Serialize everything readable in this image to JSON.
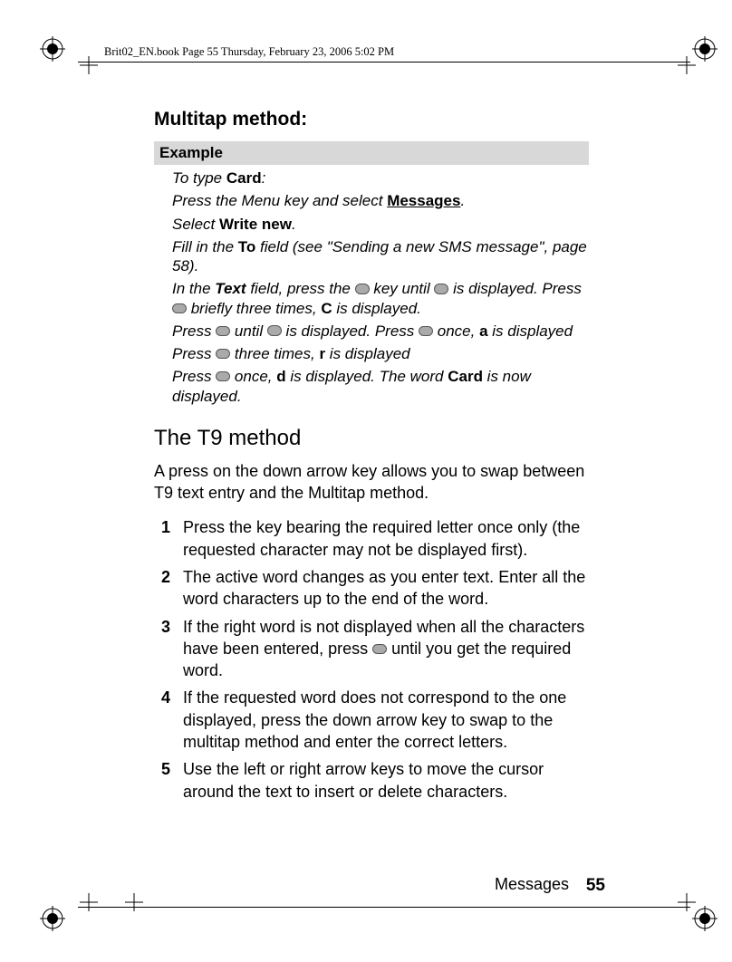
{
  "header": {
    "runner": "Brit02_EN.book  Page 55  Thursday, February 23, 2006  5:02 PM"
  },
  "section": {
    "title": "Multitap method:",
    "example_label": "Example",
    "example": {
      "line1_pre": "To type ",
      "line1_bold": "Card",
      "line1_post": ":",
      "line2_pre": "Press the Menu key and select ",
      "line2_bold": "Messages",
      "line2_post": ".",
      "line3_pre": "Select ",
      "line3_bold": "Write new",
      "line3_post": ".",
      "line4_pre": "Fill in the ",
      "line4_bold": "To",
      "line4_post": " field (see \"Sending a new SMS message\", page 58).",
      "line5_pre": "In the ",
      "line5_bold": "Text",
      "line5_post_a": " field, press the ",
      "line5_post_b": " key until ",
      "line5_post_c": " is displayed. Press ",
      "line5_post_d": " briefly three times, ",
      "line5_C": "C",
      "line5_end": " is displayed.",
      "line6_a": "Press ",
      "line6_b": " until ",
      "line6_c": " is displayed. Press ",
      "line6_d": " once, ",
      "line6_a_bold": "a",
      "line6_end": " is displayed",
      "line7_a": "Press ",
      "line7_b": " three times, ",
      "line7_bold": "r",
      "line7_end": " is displayed",
      "line8_a": "Press ",
      "line8_b": " once, ",
      "line8_bold": "d",
      "line8_c": " is displayed. The word ",
      "line8_card": "Card",
      "line8_end": " is now displayed."
    }
  },
  "t9": {
    "title": "The T9 method",
    "lead": "A press on the down arrow key allows you to swap between T9 text entry and the Multitap method.",
    "steps": [
      "Press the key bearing the required letter once only (the requested character may not be displayed first).",
      "The active word changes as you enter text. Enter all the word characters up to the end of the word.",
      "If the right word is not displayed when all the characters have been entered, press __KEY__ until you get the required word.",
      "If the requested word does not correspond to the one displayed, press the down arrow key to swap to the multitap method and enter the correct letters.",
      "Use the left or right arrow keys to move the cursor around the text to insert or delete characters."
    ],
    "step_numbers": [
      "1",
      "2",
      "3",
      "4",
      "5"
    ]
  },
  "footer": {
    "section_label": "Messages",
    "page": "55"
  }
}
